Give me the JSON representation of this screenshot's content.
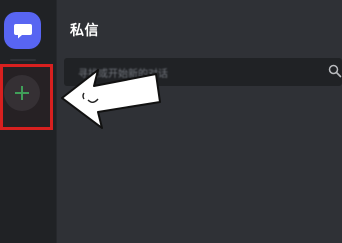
{
  "header": {
    "title": "私信"
  },
  "search": {
    "placeholder": "寻找或开始新的对话"
  },
  "icons": {
    "dm_home": "chat-bubble-icon",
    "add_server": "plus-icon",
    "search": "search-icon",
    "annotation": "arrow-pointer-icon"
  },
  "colors": {
    "accent": "#5865f2",
    "add_green": "#3ba55c",
    "highlight_red": "#d8201f",
    "rail_bg": "#202225",
    "pane_bg": "#2f3136",
    "search_bg": "#202225",
    "title_text": "#ffffff",
    "placeholder_text": "#72767d"
  }
}
